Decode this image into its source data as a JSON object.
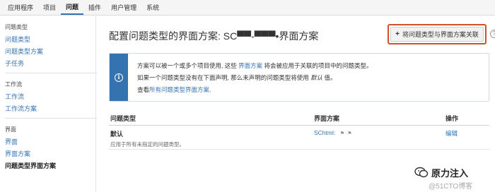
{
  "topnav": {
    "items": [
      "应用程序",
      "项目",
      "问题",
      "插件",
      "用户管理",
      "系统"
    ]
  },
  "sidebar": {
    "sections": [
      {
        "heading": "问题类型",
        "links": [
          "问题类型",
          "问题类型方案",
          "子任务"
        ]
      },
      {
        "heading": "工作流",
        "links": [
          "工作流",
          "工作流方案"
        ]
      },
      {
        "heading": "界面",
        "links": [
          "界面",
          "界面方案",
          "问题类型界面方案"
        ]
      }
    ]
  },
  "main": {
    "title": "配置问题类型的界面方案: SC▀▀-▀▀▀•界面方案",
    "assoc_button": "将问题类型与界面方案关联",
    "help": "?",
    "info": {
      "line1_a": "方案可以被一个或多个项目使用, 这些",
      "line1_link": "界面方案",
      "line1_b": "将会被应用于关联的项目中的问题类型。",
      "line2_a": "如果一个问题类型没有在下面声明, 那么未声明的问题类型将使用",
      "line2_em": "默认",
      "line2_b": "值。",
      "line3_a": "查看",
      "line3_link": "所有问题类型界面方案",
      "line3_b": "."
    },
    "table": {
      "headers": [
        "问题类型",
        "界面方案",
        "操作"
      ],
      "rows": [
        {
          "type": "默认",
          "desc": "应用于所有未指定的问题类型。",
          "scheme": "SChtml:",
          "action": "编辑"
        }
      ]
    }
  },
  "watermark": {
    "name": "原力注入",
    "sub": "@51CTO博客"
  },
  "colors": {
    "accent": "#3572b0",
    "highlight": "#d0502a"
  }
}
